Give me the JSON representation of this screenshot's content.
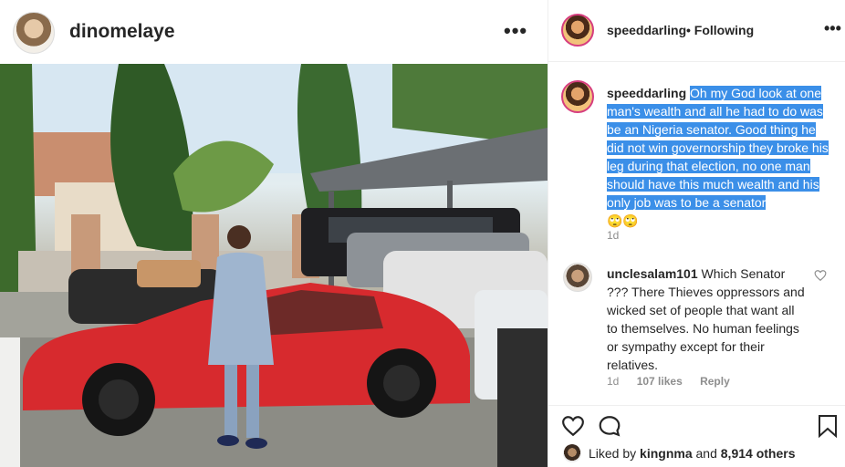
{
  "post": {
    "author": "dinomelaye",
    "more_label": "•••"
  },
  "panel": {
    "user": "speeddarling",
    "separator": "•",
    "follow_status": "Following",
    "more_label": "•••",
    "caption": {
      "user": "speeddarling",
      "text": "Oh my God look at one man's wealth and all he had to do was be an Nigeria senator. Good thing he did not win governorship they broke his leg during that election, no one man should have this much wealth and his only job was to be a senator",
      "emoji": "🙄🙄",
      "time": "1d"
    },
    "comment": {
      "user": "unclesalam101",
      "text": "Which Senator ??? There Thieves oppressors and wicked set of people that want all to themselves. No human feelings or sympathy except for their relatives.",
      "time": "1d",
      "likes": "107 likes",
      "reply": "Reply"
    },
    "liked_by": {
      "prefix": "Liked by",
      "user": "kingnma",
      "conj": "and",
      "others": "8,914 others"
    }
  }
}
